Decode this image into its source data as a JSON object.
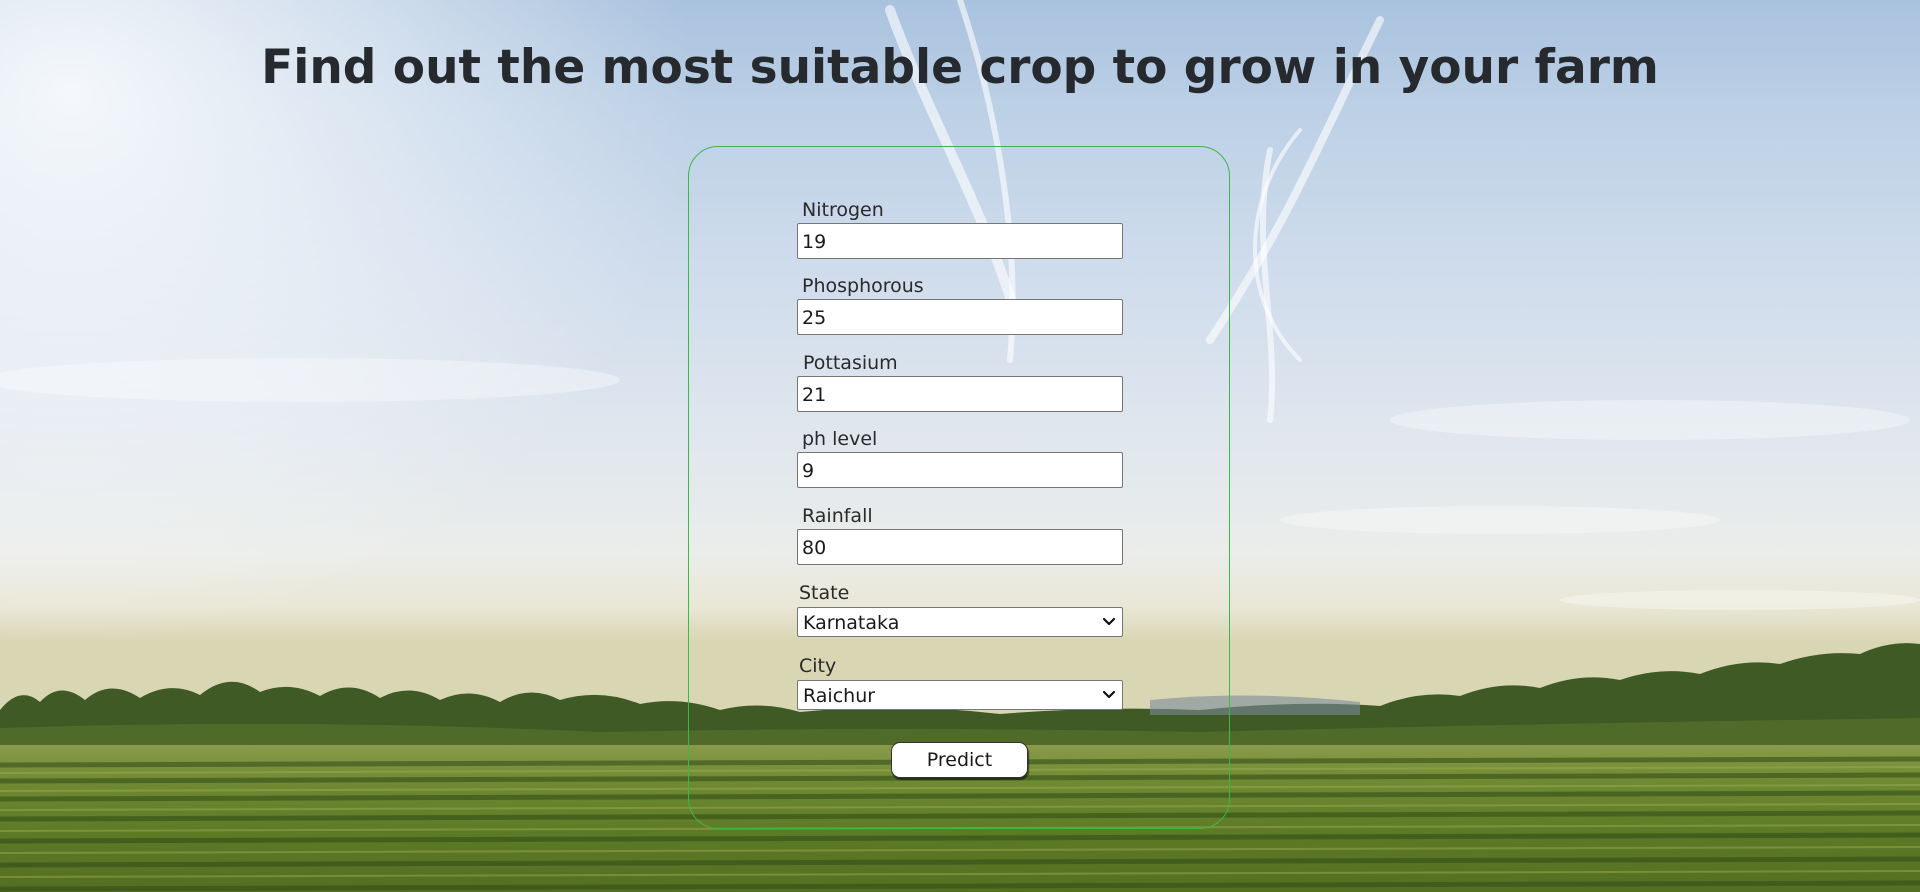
{
  "page": {
    "title": "Find out the most suitable crop to grow in your farm"
  },
  "form": {
    "nitrogen": {
      "label": "Nitrogen",
      "value": "19"
    },
    "phosphorous": {
      "label": "Phosphorous",
      "value": "25"
    },
    "pottasium": {
      "label": "Pottasium",
      "value": "21"
    },
    "ph": {
      "label": "ph level",
      "value": "9"
    },
    "rainfall": {
      "label": "Rainfall",
      "value": "80"
    },
    "state": {
      "label": "State",
      "selected": "Karnataka"
    },
    "city": {
      "label": "City",
      "selected": "Raichur"
    },
    "predict_label": "Predict"
  },
  "colors": {
    "card_border": "#3fb64a",
    "title_text": "#262a2e"
  },
  "icons": {
    "select_arrow": "chevron-down-icon"
  }
}
